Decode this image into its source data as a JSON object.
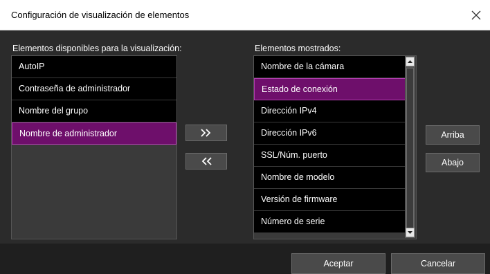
{
  "window": {
    "title": "Configuración de visualización de elementos",
    "close_icon": "close-icon"
  },
  "available": {
    "label": "Elementos disponibles para la visualización:",
    "items": [
      "AutoIP",
      "Contraseña de administrador",
      "Nombre del grupo",
      "Nombre de administrador"
    ],
    "selected_index": 3
  },
  "displayed": {
    "label": "Elementos mostrados:",
    "items": [
      "Nombre de la cámara",
      "Estado de conexión",
      "Dirección IPv4",
      "Dirección IPv6",
      "SSL/Núm. puerto",
      "Nombre de modelo",
      "Versión de firmware",
      "Número de serie"
    ],
    "selected_index": 1
  },
  "transfer": {
    "add_label": ">>",
    "remove_label": "<<"
  },
  "order": {
    "up_label": "Arriba",
    "down_label": "Abajo"
  },
  "footer": {
    "ok_label": "Aceptar",
    "cancel_label": "Cancelar"
  },
  "colors": {
    "selection": "#6e0f6b",
    "selection_border": "#b23eb0",
    "background": "#2b2b2b"
  }
}
